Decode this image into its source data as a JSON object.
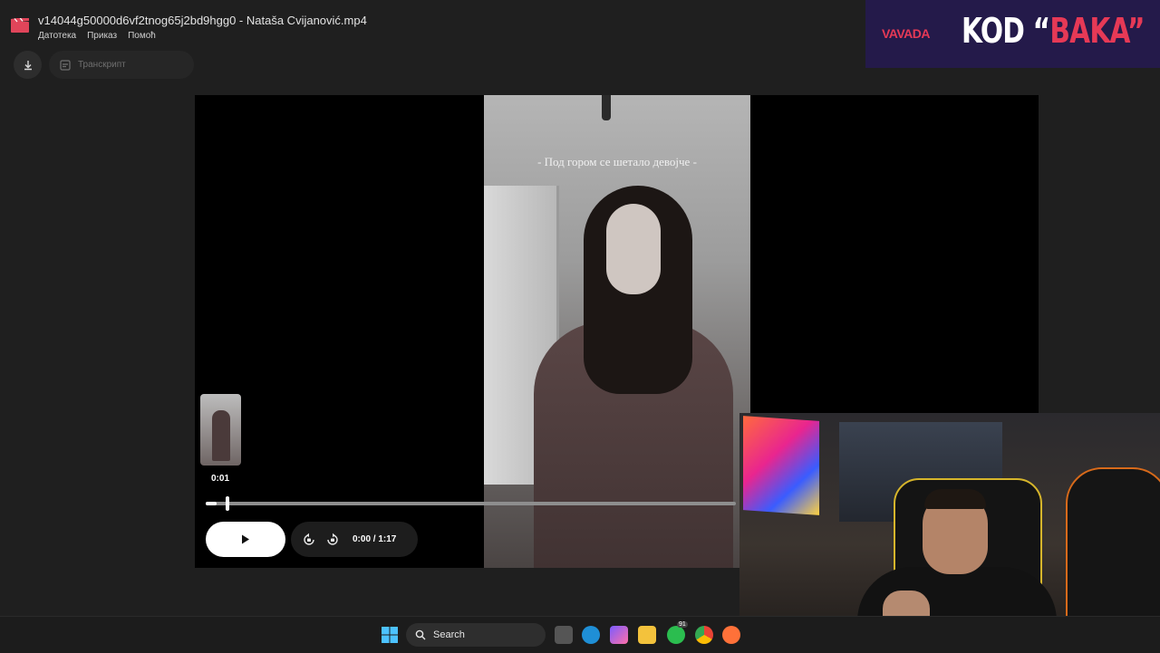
{
  "window": {
    "title": "v14044g50000d6vf2tnog65j2bd9hgg0 - Nataša Cvijanović.mp4",
    "menu": [
      "Датотека",
      "Приказ",
      "Помоћ"
    ]
  },
  "toolbar": {
    "transcript_label": "Транскрипт"
  },
  "video": {
    "subtitle": "- Под гором се шетало девојче -",
    "preview_time": "0:01",
    "time_display": "0:00 / 1:17",
    "progress_fraction": 0.02
  },
  "ad": {
    "brand": "VAVADA",
    "code_prefix": "KOD “",
    "code_value": "BAKA",
    "code_suffix": "”",
    "brand_color": "#e63956"
  },
  "taskbar": {
    "search_label": "Search",
    "whatsapp_badge": "91"
  }
}
